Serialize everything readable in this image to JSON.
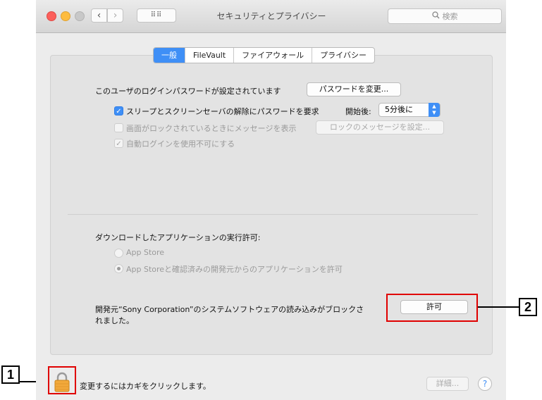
{
  "window": {
    "title": "セキュリティとプライバシー"
  },
  "toolbar": {
    "back_glyph": "‹",
    "forward_glyph": "›",
    "grid_glyph": "⠿⠿",
    "search_placeholder": "検索"
  },
  "tabs": [
    "一般",
    "FileVault",
    "ファイアウォール",
    "プライバシー"
  ],
  "general": {
    "password_set_text": "このユーザのログインパスワードが設定されています",
    "change_password_button": "パスワードを変更...",
    "require_password_label": "スリープとスクリーンセーバの解除にパスワードを要求",
    "start_after_label": "開始後:",
    "start_after_value": "5分後に",
    "show_message_label": "画面がロックされているときにメッセージを表示",
    "set_lock_message_button": "ロックのメッセージを設定...",
    "disable_auto_login_label": "自動ログインを使用不可にする",
    "downloads_heading": "ダウンロードしたアプリケーションの実行許可:",
    "radio_app_store": "App Store",
    "radio_app_store_identified": "App Storeと確認済みの開発元からのアプリケーションを許可",
    "blocked_message_line1": "開発元“Sony Corporation”のシステムソフトウェアの読み込みがブロックさ",
    "blocked_message_line2": "れました。",
    "allow_button": "許可"
  },
  "footer": {
    "lock_text": "変更するにはカギをクリックします。",
    "advanced_button": "詳細...",
    "help_glyph": "?"
  },
  "callouts": {
    "one": "1",
    "two": "2"
  },
  "colors": {
    "accent": "#3f8ff6",
    "callout_box": "#e00000"
  },
  "icons": {
    "lock": "lock-icon",
    "search": "search-icon",
    "grid": "grid-icon",
    "back": "chevron-left-icon",
    "forward": "chevron-right-icon",
    "help": "help-icon"
  }
}
